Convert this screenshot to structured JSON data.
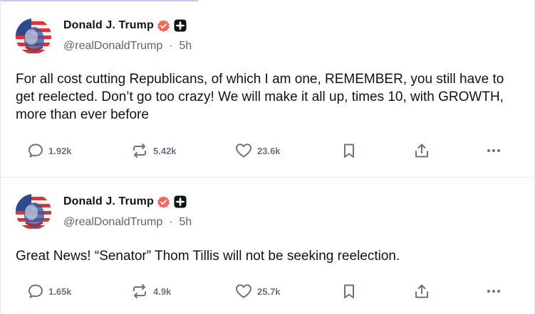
{
  "posts": [
    {
      "author": {
        "display_name": "Donald J. Trump",
        "handle": "@realDonaldTrump",
        "time": "5h"
      },
      "text": "For all cost cutting Republicans, of which I am one, REMEMBER, you still have to get reelected. Don’t go too crazy! We will make it all up, times 10, with GROWTH, more than ever before",
      "stats": {
        "replies": "1.92k",
        "reposts": "5.42k",
        "likes": "23.6k"
      }
    },
    {
      "author": {
        "display_name": "Donald J. Trump",
        "handle": "@realDonaldTrump",
        "time": "5h"
      },
      "text": "Great News! “Senator” Thom Tillis will not be seeking reelection.",
      "stats": {
        "replies": "1.65k",
        "reposts": "4.9k",
        "likes": "25.7k"
      }
    }
  ],
  "separator": "·",
  "icons": {
    "reply": "comment-bubble-icon",
    "repost": "repost-arrows-icon",
    "like": "heart-icon",
    "bookmark": "bookmark-icon",
    "share": "share-upload-icon",
    "more": "more-dots-icon",
    "verified": "verified-check-badge-icon",
    "plus": "plus-square-badge-icon"
  },
  "colors": {
    "verified_badge": "#f06a5a",
    "icon_gray": "#6b7280",
    "text": "#0f1419",
    "muted": "#5b6470"
  }
}
